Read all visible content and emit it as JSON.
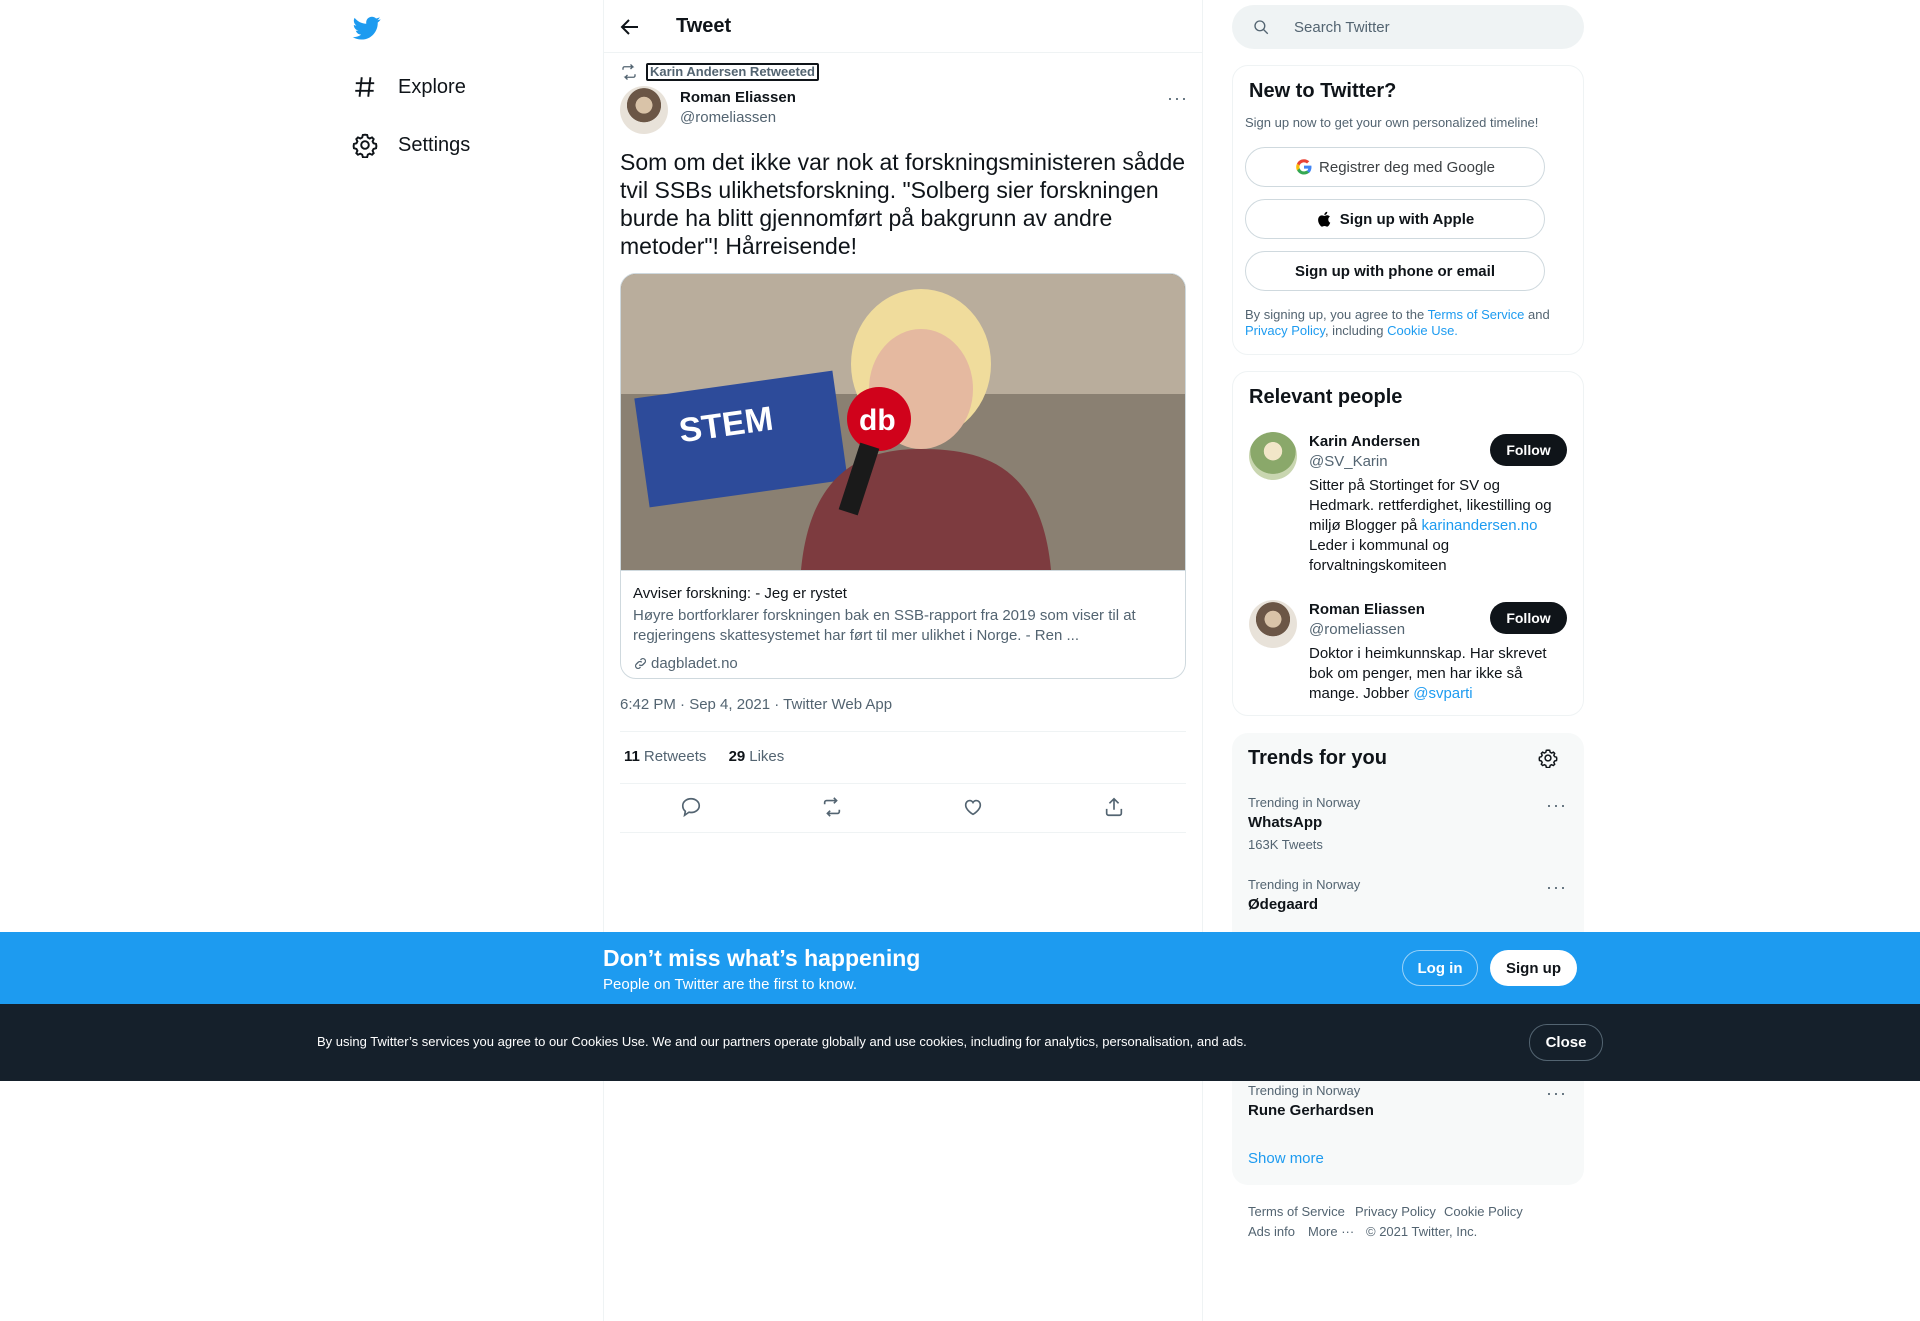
{
  "nav": {
    "items": [
      {
        "label": "Explore"
      },
      {
        "label": "Settings"
      }
    ]
  },
  "header": {
    "title": "Tweet"
  },
  "tweet": {
    "retweeted_by": "Karin Andersen Retweeted",
    "author_name": "Roman Eliassen",
    "author_handle": "@romeliassen",
    "text": "Som om det ikke var nok at forskningsministeren sådde tvil SSBs ulikhetsforskning. \"Solberg sier forskningen burde ha blitt gjennomført på bakgrunn av andre metoder\"! Hårreisende!",
    "card": {
      "title": "Avviser forskning: - Jeg er rystet",
      "description": "Høyre bortforklarer forskningen bak en SSB-rapport fra 2019 som viser til at regjeringens skattesystemet har ført til mer ulikhet i Norge. - Ren ...",
      "domain": "dagbladet.no"
    },
    "meta": "6:42 PM · Sep 4, 2021 · Twitter Web App",
    "retweets_count": "11",
    "retweets_label": "Retweets",
    "likes_count": "29",
    "likes_label": "Likes"
  },
  "search": {
    "placeholder": "Search Twitter"
  },
  "signup_box": {
    "title": "New to Twitter?",
    "subtitle": "Sign up now to get your own personalized timeline!",
    "google_label": "Registrer deg med Google",
    "apple_label": "Sign up with Apple",
    "phone_label": "Sign up with phone or email",
    "legal_prefix": "By signing up, you agree to the ",
    "terms": "Terms of Service",
    "and": " and ",
    "privacy": "Privacy Policy",
    "including": ", including ",
    "cookie_use": "Cookie Use."
  },
  "relevant": {
    "title": "Relevant people",
    "people": [
      {
        "name": "Karin Andersen",
        "handle": "@SV_Karin",
        "follow_label": "Follow",
        "bio_text": "Sitter på Stortinget for SV og Hedmark. rettferdighet, likestilling og miljø Blogger på ",
        "bio_link": "karinandersen.no",
        "bio_suffix": " Leder i kommunal og forvaltningskomiteen"
      },
      {
        "name": "Roman Eliassen",
        "handle": "@romeliassen",
        "follow_label": "Follow",
        "bio_text": "Doktor i heimkunnskap. Har skrevet bok om penger, men har ikke så mange. Jobber ",
        "bio_link": "@svparti",
        "bio_suffix": ""
      }
    ]
  },
  "trends": {
    "title": "Trends for you",
    "items": [
      {
        "context": "Trending in Norway",
        "name": "WhatsApp",
        "count": "163K Tweets"
      },
      {
        "context": "Trending in Norway",
        "name": "Ødegaard",
        "count": ""
      },
      {
        "context": "Trending in Norway",
        "name": "Rune Gerhardsen",
        "count": ""
      }
    ],
    "show_more": "Show more"
  },
  "footer": {
    "terms": "Terms of Service",
    "privacy": "Privacy Policy",
    "cookie": "Cookie Policy",
    "ads": "Ads info",
    "more": "More ···",
    "copyright": "© 2021 Twitter, Inc."
  },
  "banner": {
    "title": "Don’t miss what’s happening",
    "subtitle": "People on Twitter are the first to know.",
    "login": "Log in",
    "signup": "Sign up"
  },
  "cookie_bar": {
    "text": "By using Twitter’s services you agree to our Cookies Use. We and our partners operate globally and use cookies, including for analytics, personalisation, and ads.",
    "close": "Close"
  },
  "colors": {
    "accent": "#1d9bf0",
    "text": "#0f1419",
    "secondary": "#536471",
    "cookie_bg": "#15202b"
  },
  "icons": [
    "twitter-logo-icon",
    "hashtag-icon",
    "gear-icon",
    "back-arrow-icon",
    "retweet-icon",
    "more-icon",
    "link-icon",
    "reply-icon",
    "like-icon",
    "share-icon",
    "search-icon",
    "google-icon",
    "apple-icon"
  ]
}
